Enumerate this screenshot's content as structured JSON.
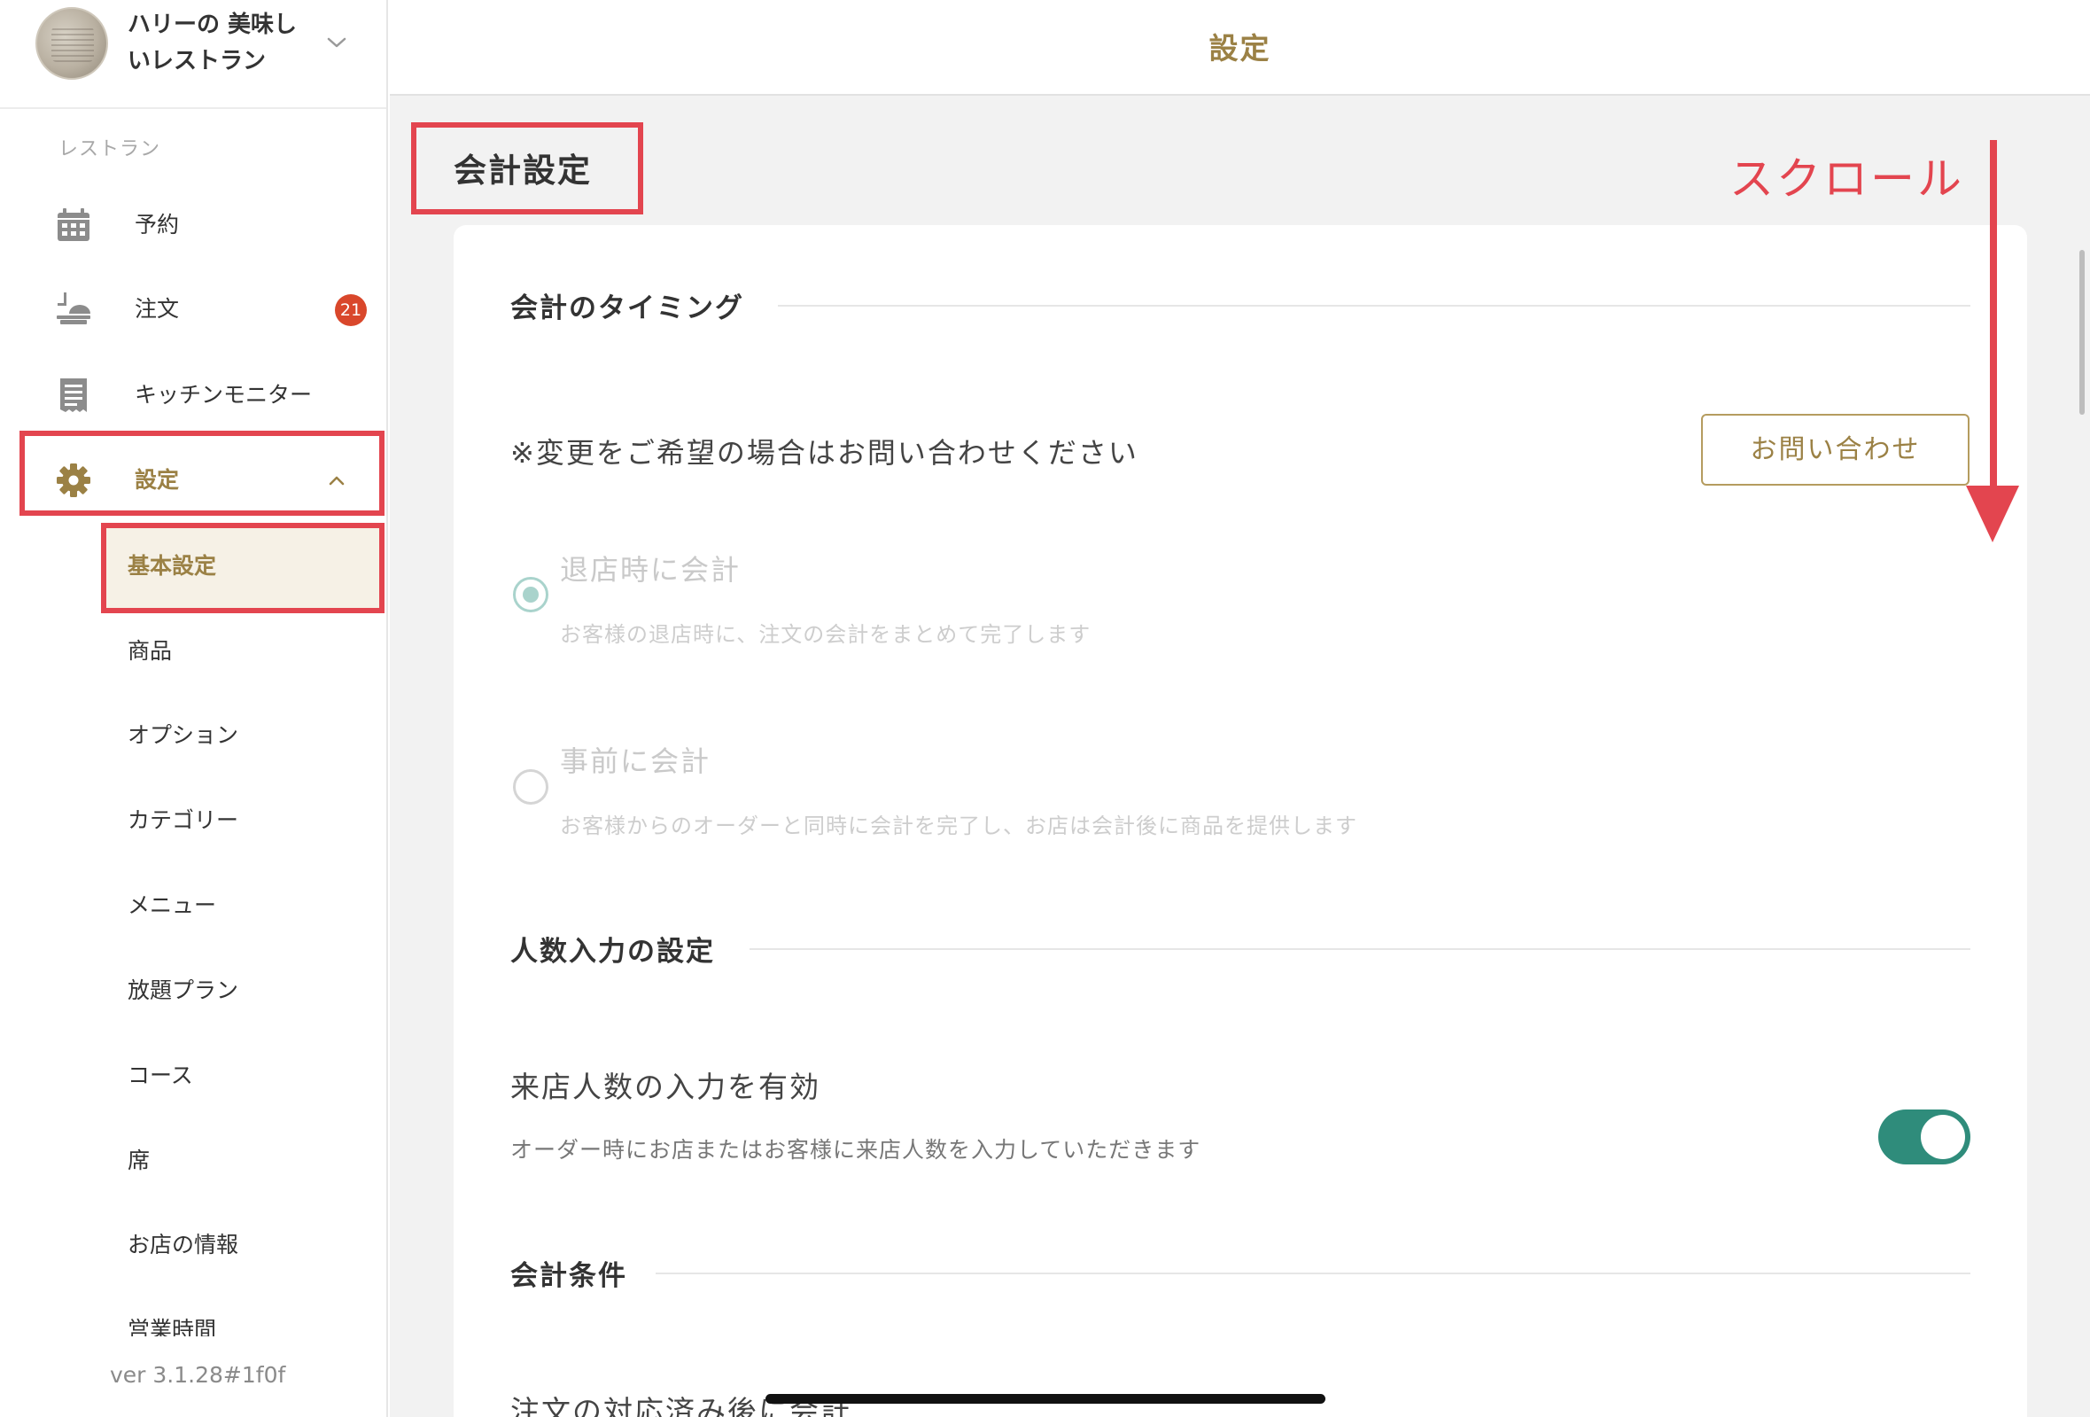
{
  "sidebar": {
    "restaurant_name": "ハリーの 美味しいレストラン",
    "section_label": "レストラン",
    "nav": {
      "reservations": "予約",
      "orders": "注文",
      "orders_badge": "21",
      "kitchen_monitor": "キッチンモニター",
      "settings": "設定"
    },
    "sub_items": {
      "basic": "基本設定",
      "products": "商品",
      "options": "オプション",
      "categories": "カテゴリー",
      "menu": "メニュー",
      "all_you_can": "放題プラン",
      "course": "コース",
      "seats": "席",
      "store_info": "お店の情報",
      "business_hours": "営業時間"
    },
    "version": "ver 3.1.28#1f0f"
  },
  "header": {
    "title": "設定"
  },
  "main": {
    "section_title": "会計設定",
    "scroll_annotation": "スクロール",
    "checkout_timing": {
      "title": "会計のタイミング",
      "notice": "※変更をご希望の場合はお問い合わせください",
      "contact_button": "お問い合わせ",
      "option_after": {
        "title": "退店時に会計",
        "desc": "お客様の退店時に、注文の会計をまとめて完了します",
        "selected": true
      },
      "option_before": {
        "title": "事前に会計",
        "desc": "お客様からのオーダーと同時に会計を完了し、お店は会計後に商品を提供します",
        "selected": false
      }
    },
    "guest_count": {
      "title": "人数入力の設定",
      "label": "来店人数の入力を有効",
      "desc": "オーダー時にお店またはお客様に来店人数を入力していただきます",
      "enabled": true
    },
    "checkout_conditions": {
      "title": "会計条件",
      "label": "注文の対応済み後に会計"
    }
  },
  "colors": {
    "accent_gold": "#9b8145",
    "annotation_red": "#e3454f",
    "toggle_green": "#2f8c7b",
    "badge_red": "#d9472b"
  }
}
